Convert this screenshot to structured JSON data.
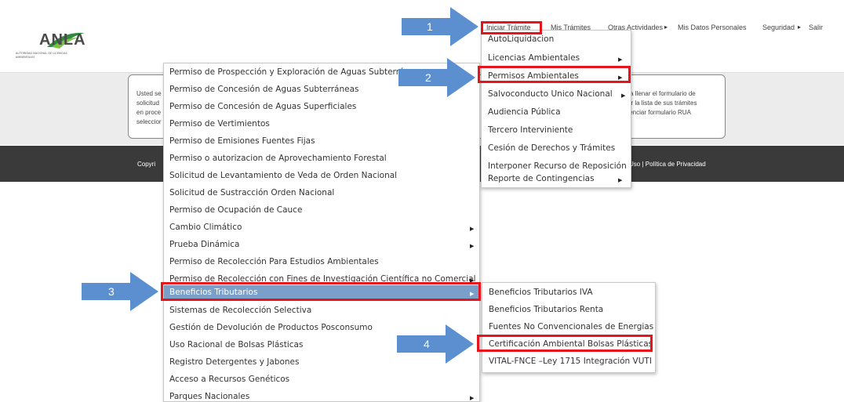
{
  "header": {
    "logo_text": "ANLA",
    "logo_sub": "AUTORIDAD NACIONAL DE LICENCIAS AMBIENTALES",
    "nav": [
      "Iniciar Trámite",
      "Mis Trámites",
      "Otras Actividades",
      "Mis Datos Personales",
      "Seguridad",
      "Salir"
    ],
    "nav_arrow": "▸"
  },
  "info_box": {
    "left_lines": "Usted se\nsolicitud\nen proce\nseleccior",
    "right_lines": "ara llenar el formulario de\nver la lista de sus trámites\nigenciar formulario RUA"
  },
  "footer": {
    "left": "Copyri",
    "right": "Uso | Política de Privacidad"
  },
  "menu_main": {
    "items": [
      "AutoLiquidacion",
      "Licencias Ambientales",
      "Permisos Ambientales",
      "Salvoconducto Unico Nacional",
      "Audiencia Pública",
      "Tercero Interviniente",
      "Cesión de Derechos y Trámites",
      "Interponer Recurso de Reposición",
      "Reporte de Contingencias"
    ]
  },
  "menu_permisos": {
    "items": [
      "Permiso de Prospección y Exploración de Aguas Subterráne",
      "Permiso de Concesión de Aguas Subterráneas",
      "Permiso de Concesión de Aguas Superficiales",
      "Permiso de Vertimientos",
      "Permiso de Emisiones Fuentes Fijas",
      "Permiso o autorizacion de Aprovechamiento Forestal",
      "Solicitud de Levantamiento de Veda de Orden Nacional",
      "Solicitud de Sustracción Orden Nacional",
      "Permiso de Ocupación de Cauce",
      "Cambio Climático",
      "Prueba Dinámica",
      "Permiso de Recolección Para Estudios Ambientales",
      "Permiso de Recolección con Fines de Investigación Científica no Comercial",
      "Beneficios Tributarios",
      "Sistemas de Recolección Selectiva",
      "Gestión de Devolución de Productos Posconsumo",
      "Uso Racional de Bolsas Plásticas",
      "Registro Detergentes y Jabones",
      "Acceso a Recursos Genéticos",
      "Parques Nacionales"
    ]
  },
  "menu_beneficios": {
    "items": [
      "Beneficios Tributarios IVA",
      "Beneficios Tributarios Renta",
      "Fuentes No Convencionales de Energias",
      "Certificación Ambiental Bolsas Plásticas",
      "VITAL-FNCE –Ley 1715 Integración VUTI"
    ]
  },
  "submenu_arrow": "▶",
  "callouts": [
    "1",
    "2",
    "3",
    "4"
  ],
  "colors": {
    "highlight": "#7aa0c9",
    "callout_blue": "#5b8fd0",
    "red_box": "#e8141c",
    "footer_bg": "#3a3a3a"
  }
}
